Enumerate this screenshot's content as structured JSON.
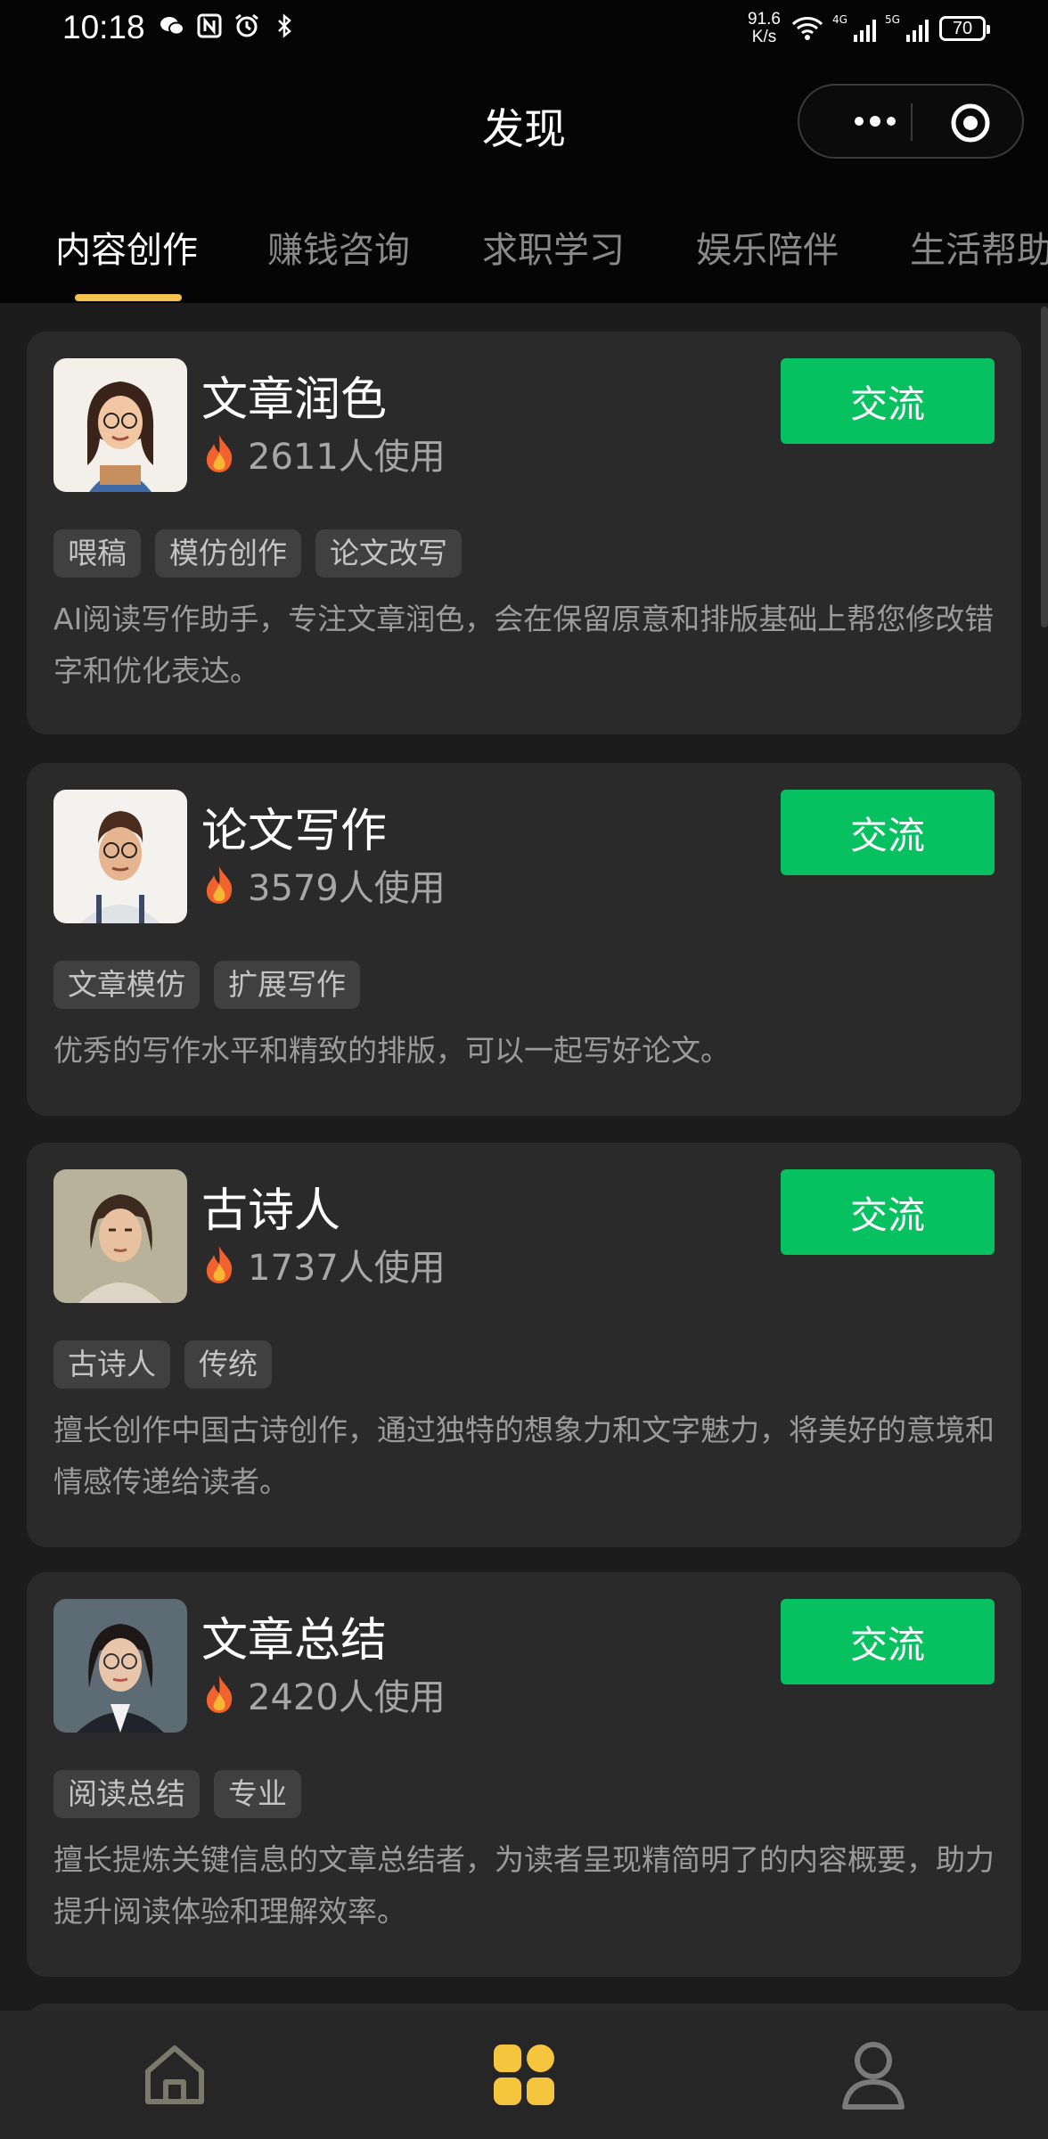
{
  "status_bar": {
    "time": "10:18",
    "net_speed_value": "91.6",
    "net_speed_unit": "K/s",
    "sig1_label": "4G",
    "sig2_label": "5G",
    "battery": "70"
  },
  "header": {
    "title": "发现"
  },
  "tabs": [
    {
      "label": "内容创作",
      "active": true
    },
    {
      "label": "赚钱咨询",
      "active": false
    },
    {
      "label": "求职学习",
      "active": false
    },
    {
      "label": "娱乐陪伴",
      "active": false
    },
    {
      "label": "生活帮助",
      "active": false
    }
  ],
  "cards": [
    {
      "name": "文章润色",
      "usage": "2611人使用",
      "button": "交流",
      "tags": [
        "喂稿",
        "模仿创作",
        "论文改写"
      ],
      "description": "AI阅读写作助手，专注文章润色，会在保留原意和排版基础上帮您修改错字和优化表达。"
    },
    {
      "name": "论文写作",
      "usage": "3579人使用",
      "button": "交流",
      "tags": [
        "文章模仿",
        "扩展写作"
      ],
      "description": "优秀的写作水平和精致的排版，可以一起写好论文。"
    },
    {
      "name": "古诗人",
      "usage": "1737人使用",
      "button": "交流",
      "tags": [
        "古诗人",
        "传统"
      ],
      "description": "擅长创作中国古诗创作，通过独特的想象力和文字魅力，将美好的意境和情感传递给读者。"
    },
    {
      "name": "文章总结",
      "usage": "2420人使用",
      "button": "交流",
      "tags": [
        "阅读总结",
        "专业"
      ],
      "description": "擅长提炼关键信息的文章总结者，为读者呈现精简明了的内容概要，助力提升阅读体验和理解效率。"
    }
  ],
  "bottom_nav": [
    {
      "icon": "home-icon",
      "active": false
    },
    {
      "icon": "discover-grid-icon",
      "active": true
    },
    {
      "icon": "profile-icon",
      "active": false
    }
  ],
  "colors": {
    "accent_green": "#07c160",
    "accent_yellow": "#f2c14e",
    "background": "#1c1c1c",
    "card": "#2a2a2a"
  }
}
